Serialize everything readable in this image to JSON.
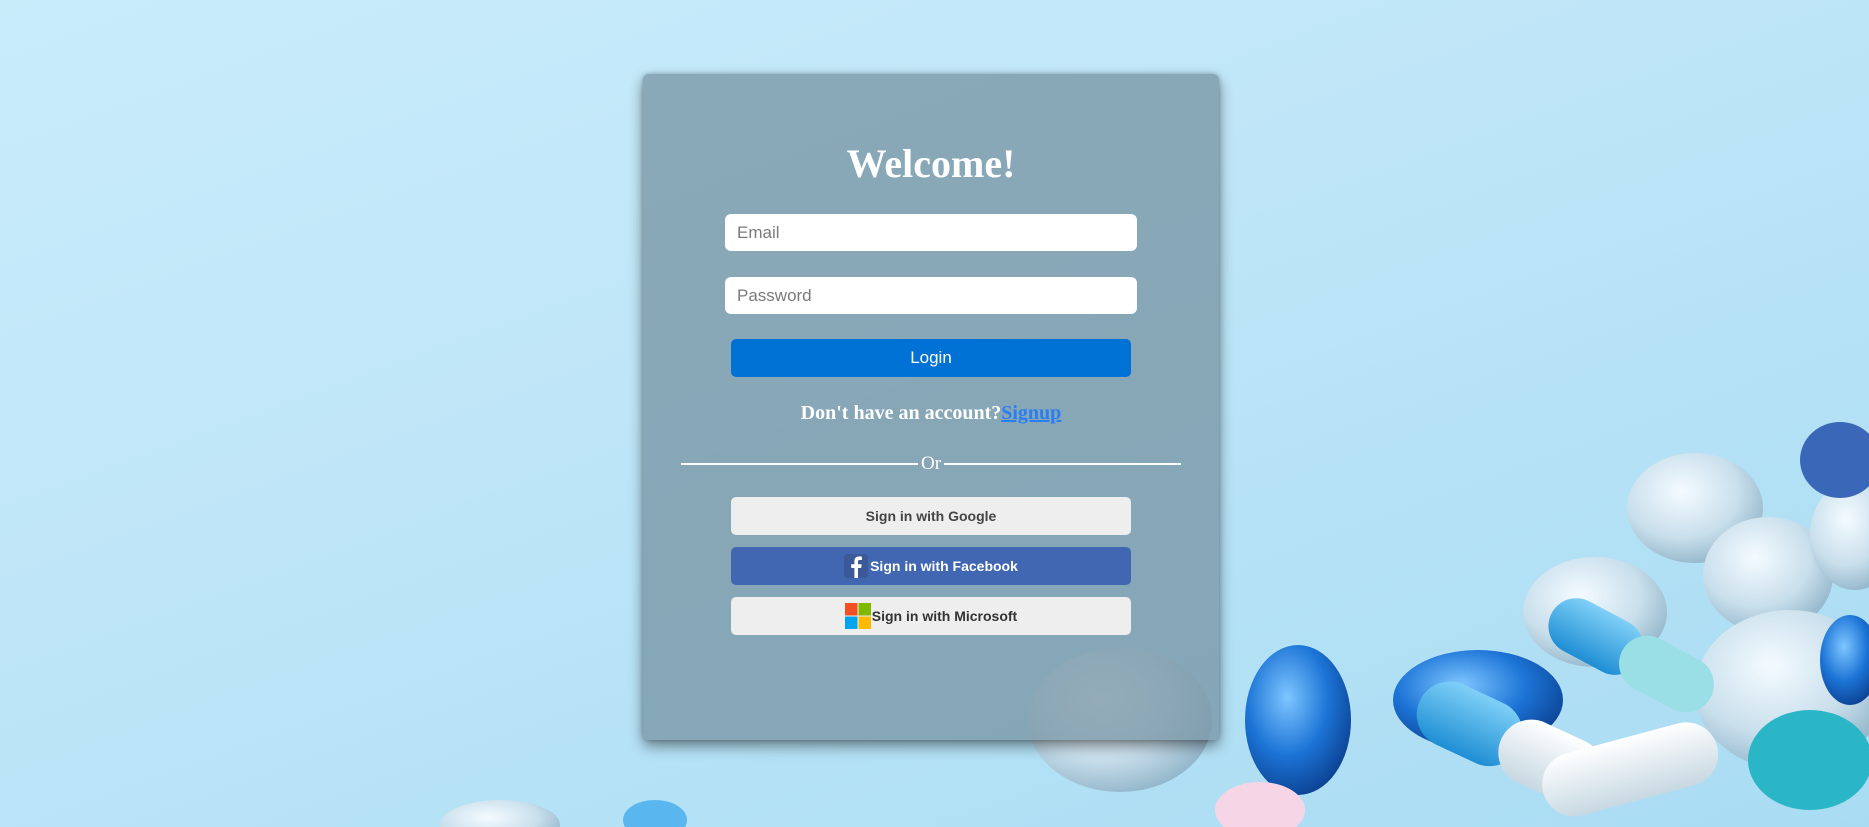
{
  "login_card": {
    "title": "Welcome!",
    "email_placeholder": "Email",
    "password_placeholder": "Password",
    "login_label": "Login",
    "signup_prompt": "Don't have an account?",
    "signup_link": "Signup",
    "divider_text": "Or",
    "google_label": "Sign in with Google",
    "facebook_label": "Sign in with Facebook",
    "microsoft_label": "Sign in with Microsoft"
  },
  "colors": {
    "login_button": "#0072d6",
    "facebook_button": "#4267b2",
    "signup_link": "#2a7ef2",
    "card": "rgba(120,150,165,0.78)"
  },
  "icons": {
    "facebook": "facebook-icon",
    "microsoft": "microsoft-icon"
  }
}
